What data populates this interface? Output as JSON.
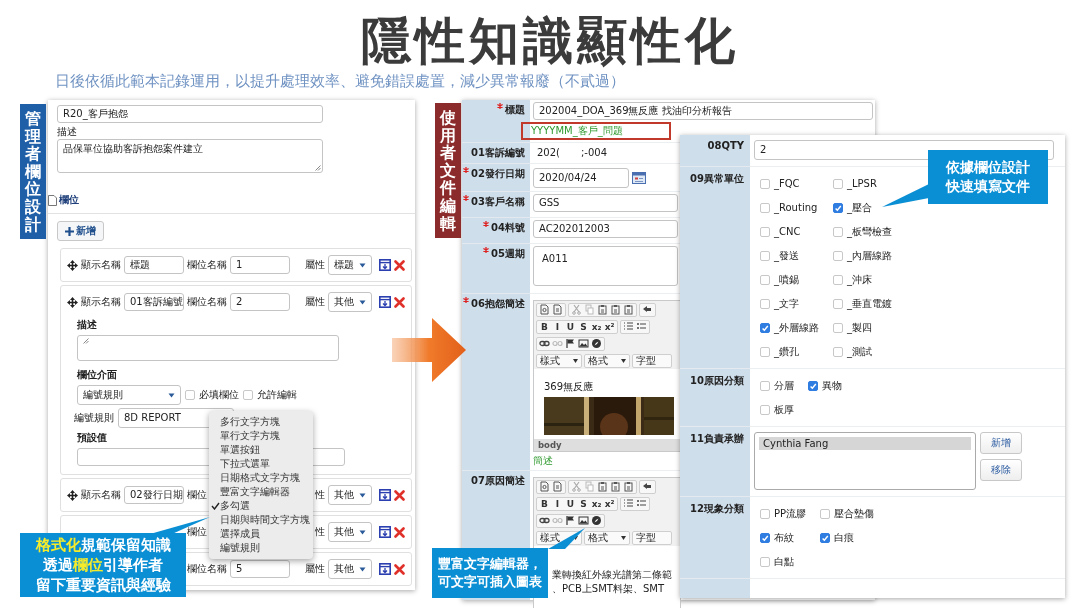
{
  "title": "隱性知識顯性化",
  "subtitle": "日後依循此範本記錄運用，以提升處理效率、避免錯誤處置，減少異常報廢（不貳過）",
  "admin": {
    "badge": "管理者欄位設計",
    "name_value": "R20_客戶抱怨",
    "desc_label": "描述",
    "desc_value": "品保單位協助客訴抱怨案件建立",
    "fields_heading": "欄位",
    "add_button": "新增",
    "rows": [
      {
        "kind": "collapsed",
        "name_label": "顯示名稱",
        "name_value": "標題",
        "field_label": "欄位名稱",
        "field_value": "1",
        "attr_label": "屬性",
        "attr_value": "標題"
      },
      {
        "kind": "expanded",
        "name_label": "顯示名稱",
        "name_value": "01客訴編號",
        "field_label": "欄位名稱",
        "field_value": "2",
        "attr_label": "屬性",
        "attr_value": "其他",
        "detail": {
          "desc_label": "描述",
          "ui_label": "欄位介面",
          "ui_value": "編號規則",
          "required": {
            "label": "必填欄位",
            "checked": false
          },
          "editable": {
            "label": "允許編輯",
            "checked": false
          },
          "rule_label": "編號規則",
          "rule_value": "8D REPORT",
          "default_label": "預設值"
        }
      },
      {
        "kind": "collapsed",
        "name_label": "顯示名稱",
        "name_value": "02發行日期",
        "field_label": "欄位",
        "attr_label": "性",
        "attr_value": "其他"
      },
      {
        "kind": "collapsed",
        "field_label": "欄位",
        "attr_label": "性",
        "attr_value": "其他"
      },
      {
        "kind": "collapsed",
        "field_label": "欄位名稱",
        "field_value": "5",
        "attr_label": "屬性",
        "attr_value": "其他"
      }
    ],
    "menu": {
      "options": [
        {
          "label": "多行文字方塊",
          "selected": false
        },
        {
          "label": "單行文字方塊",
          "selected": false
        },
        {
          "label": "單選按鈕",
          "selected": false
        },
        {
          "label": "下拉式選單",
          "selected": false
        },
        {
          "label": "日期格式文字方塊",
          "selected": false
        },
        {
          "label": "豐富文字編輯器",
          "selected": false
        },
        {
          "label": "多勾選",
          "selected": true
        },
        {
          "label": "日期與時間文字方塊",
          "selected": false
        },
        {
          "label": "選擇成員",
          "selected": false
        },
        {
          "label": "編號規則",
          "selected": false
        }
      ]
    }
  },
  "user": {
    "badge": "使用者文件編輯",
    "rows": [
      {
        "kind": "input",
        "label": "標題",
        "required": true,
        "value": "202004_DOA_369無反應 找油印分析報告",
        "hint": "YYYYMM_客戶_問題"
      },
      {
        "kind": "text",
        "label": "01客訴編號",
        "required": false,
        "values": [
          "202(",
          ";-004"
        ]
      },
      {
        "kind": "date",
        "label": "02發行日期",
        "required": true,
        "value": "2020/04/24"
      },
      {
        "kind": "input",
        "label": "03客戶名稱",
        "required": true,
        "value": "GSS"
      },
      {
        "kind": "input",
        "label": "04料號",
        "required": true,
        "value": "AC202012003"
      },
      {
        "kind": "textarea",
        "label": "05週期",
        "required": true,
        "value": "A011"
      },
      {
        "kind": "editor",
        "label": "06抱怨簡述",
        "required": true,
        "format_buttons": [
          "B",
          "I",
          "U",
          "S",
          "x₂",
          "x²"
        ],
        "dropdowns": [
          "樣式",
          "格式",
          "字型"
        ],
        "content": "369無反應",
        "picture": true,
        "status": "body",
        "note": "簡述"
      },
      {
        "kind": "editor",
        "label": "07原因簡述",
        "required": false,
        "format_buttons": [
          "B",
          "I",
          "U",
          "S",
          "x₂",
          "x²"
        ],
        "dropdowns": [
          "樣式",
          "格式",
          "字型"
        ],
        "lines": [
          "業轉換紅外線光譜第二條範",
          "、PCB上SMT料架、SMT"
        ]
      }
    ]
  },
  "fill": {
    "rows": [
      {
        "kind": "input",
        "label": "08QTY",
        "value": "2"
      },
      {
        "kind": "checks",
        "label": "09異常單位",
        "options": [
          {
            "label": "_FQC",
            "checked": false
          },
          {
            "label": "_LPSR",
            "checked": false
          },
          {
            "label": "_Routing",
            "checked": false
          },
          {
            "label": "_壓合",
            "checked": true
          },
          {
            "label": "_CNC",
            "checked": false
          },
          {
            "label": "_板彎檢查",
            "checked": false
          },
          {
            "label": "_發送",
            "checked": false
          },
          {
            "label": "_內層線路",
            "checked": false
          },
          {
            "label": "_噴錫",
            "checked": false
          },
          {
            "label": "_沖床",
            "checked": false
          },
          {
            "label": "_文字",
            "checked": false
          },
          {
            "label": "_垂直電鍍",
            "checked": false
          },
          {
            "label": "_外層線路",
            "checked": true
          },
          {
            "label": "_製四",
            "checked": false
          },
          {
            "label": "_鑽孔",
            "checked": false
          },
          {
            "label": "_測試",
            "checked": false
          }
        ]
      },
      {
        "kind": "checks",
        "label": "10原因分類",
        "options": [
          {
            "label": "分層",
            "checked": false
          },
          {
            "label": "異物",
            "checked": true
          },
          {
            "label": "板厚",
            "checked": false
          }
        ]
      },
      {
        "kind": "people",
        "label": "11負責承辦",
        "people": [
          {
            "name": "Cynthia Fang",
            "selected": true
          }
        ],
        "buttons": [
          "新增",
          "移除"
        ]
      },
      {
        "kind": "checks",
        "label": "12現象分類",
        "options": [
          {
            "label": "PP流膠",
            "checked": false
          },
          {
            "label": "壓合墊傷",
            "checked": false
          },
          {
            "label": "布紋",
            "checked": true
          },
          {
            "label": "白痕",
            "checked": true
          },
          {
            "label": "白點",
            "checked": false
          }
        ]
      }
    ]
  },
  "callouts": [
    {
      "lines": [
        [
          {
            "text": "格式化",
            "highlight": true
          },
          {
            "text": "規範保留知識",
            "highlight": false
          }
        ],
        [
          {
            "text": "透過",
            "highlight": false
          },
          {
            "text": "欄位",
            "highlight": true
          },
          {
            "text": "引導作者",
            "highlight": false
          }
        ],
        [
          {
            "text": "留下重要資訊與經驗",
            "highlight": false
          }
        ]
      ]
    },
    {
      "lines": [
        [
          {
            "text": "豐富文字編輯器，",
            "highlight": false
          }
        ],
        [
          {
            "text": "可文字可插入圖表",
            "highlight": false
          }
        ]
      ]
    },
    {
      "lines": [
        [
          {
            "text": "依據欄位設計",
            "highlight": false
          }
        ],
        [
          {
            "text": "快速填寫文件",
            "highlight": false
          }
        ]
      ]
    }
  ]
}
